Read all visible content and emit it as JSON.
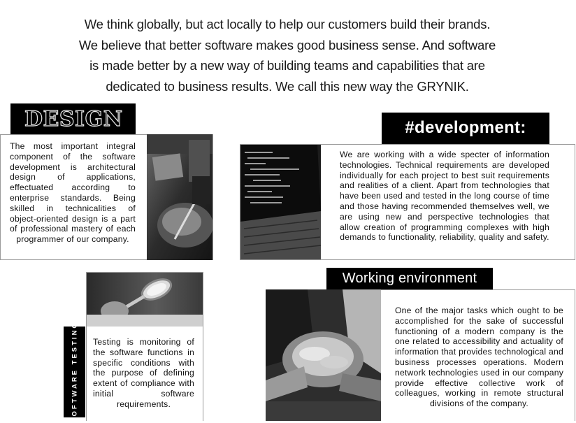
{
  "intro": {
    "text": "We think globally, but act locally to help our customers build their brands. We believe that better software makes good business sense. And software is made better by a new way of building teams and capabilities that are dedicated to business results. We call this new way the GRYNIK."
  },
  "design": {
    "title": "DESIGN",
    "text": "The most important integral component of the software development is architectural design of applications, effectuated according to enterprise standards. Being skilled in technicalities of object-oriented design is a part of professional mastery of each programmer of our company."
  },
  "development": {
    "title": "#development:",
    "text": "We are working with a wide specter of information technologies. Technical requirements are developed individually for each project to best suit requirements and realities of a client. Apart from technologies that have been used and tested in the long course of time and those having recommended themselves well, we are using new and perspective technologies that allow creation of programming complexes with high demands to functionality, reliability, quality and safety."
  },
  "testing": {
    "label": "SOFTWARE TESTING",
    "text": "Testing is monitoring of the software functions in specific conditions with the purpose of defining extent of compliance with initial software requirements."
  },
  "working": {
    "title": "Working environment",
    "text": "One of the major tasks which ought to be accomplished for the sake of successful functioning of a modern company is the one related to accessibility and actuality of information that provides technological and business processes operations. Modern network technologies used in our company provide effective collective work of colleagues, working in remote structural divisions of the company."
  }
}
